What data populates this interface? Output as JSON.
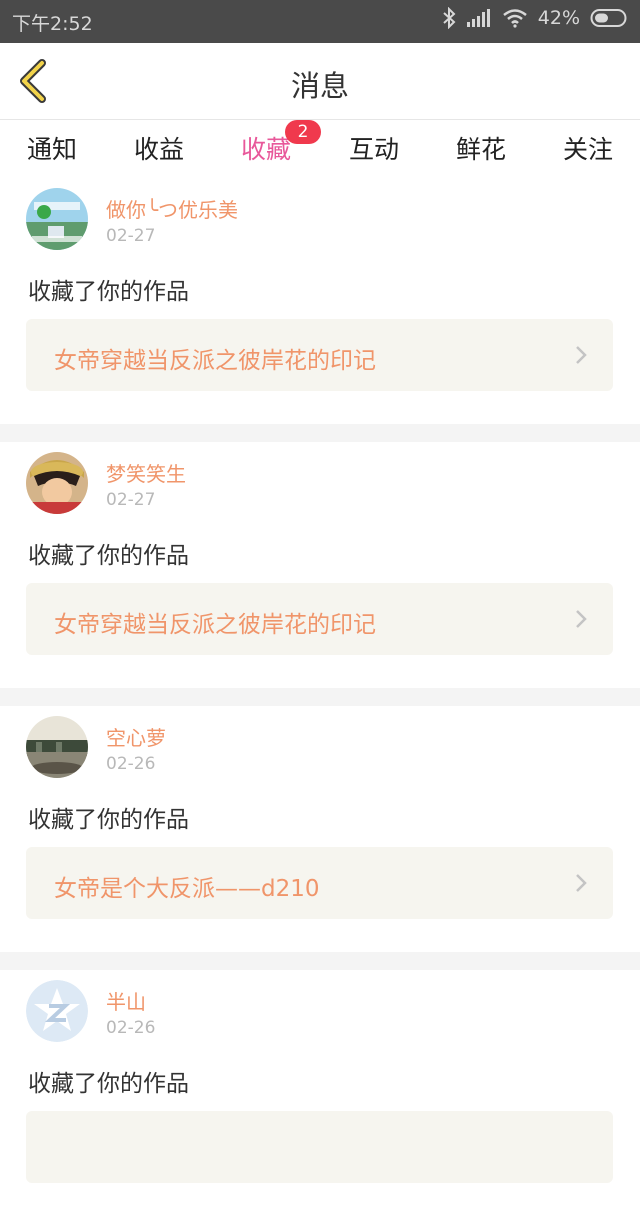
{
  "status_bar": {
    "time": "下午2:52",
    "battery": "42%"
  },
  "header": {
    "title": "消息"
  },
  "tabs": [
    {
      "label": "通知"
    },
    {
      "label": "收益"
    },
    {
      "label": "收藏",
      "badge": "2"
    },
    {
      "label": "互动"
    },
    {
      "label": "鲜花"
    },
    {
      "label": "关注"
    }
  ],
  "active_tab": "收藏",
  "feed": [
    {
      "name": "做你╰つ优乐美",
      "date": "02-27",
      "action": "收藏了你的作品",
      "work": "女帝穿越当反派之彼岸花的印记"
    },
    {
      "name": "梦笑笑生",
      "date": "02-27",
      "action": "收藏了你的作品",
      "work": "女帝穿越当反派之彼岸花的印记"
    },
    {
      "name": "空心萝",
      "date": "02-26",
      "action": "收藏了你的作品",
      "work": "女帝是个大反派——d210"
    },
    {
      "name": "半山",
      "date": "02-26",
      "action": "收藏了你的作品",
      "work": ""
    }
  ],
  "colors": {
    "accent": "#e8589a",
    "badge": "#f0394d",
    "name": "#f0956a",
    "card_bg": "#f6f5ef"
  }
}
